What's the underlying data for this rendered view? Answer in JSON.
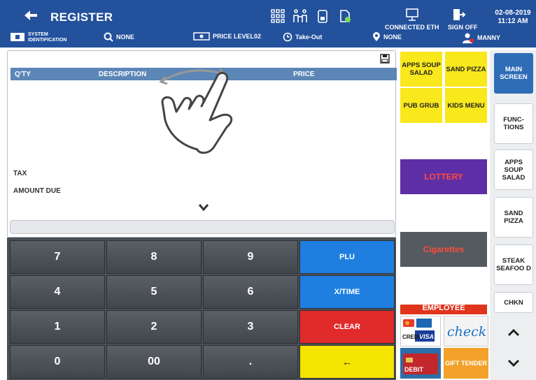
{
  "header": {
    "title": "REGISTER",
    "connected": "CONNECTED ETH",
    "sign_off": "SIGN OFF",
    "date": "02-08-2019",
    "time": "11:12 AM",
    "system_id_line1": "SYSTEM",
    "system_id_line2": "IDENTIFICATION",
    "search_none": "NONE",
    "price_level": "PRICE LEVEL02",
    "take_out": "Take-Out",
    "location_none": "NONE",
    "user": "MANNY"
  },
  "transaction": {
    "col_qty": "Q'TY",
    "col_description": "DESCRIPTION",
    "col_price": "PRICE",
    "tax_label": "TAX",
    "amount_due_label": "AMOUNT DUE"
  },
  "keypad": {
    "k7": "7",
    "k8": "8",
    "k9": "9",
    "k4": "4",
    "k5": "5",
    "k6": "6",
    "k1": "1",
    "k2": "2",
    "k3": "3",
    "k0": "0",
    "k00": "00",
    "kdot": ".",
    "plu": "PLU",
    "xtime": "X/TIME",
    "clear": "CLEAR",
    "enter": "←"
  },
  "departments": {
    "apps_soup_salad": "APPS SOUP SALAD",
    "sand_pizza": "SAND PIZZA",
    "pub_grub": "PUB GRUB",
    "kids_menu": "KIDS MENU",
    "lottery": "LOTTERY",
    "cigarettes": "Cigarettes",
    "employee": "EMPLOYEE"
  },
  "payments": {
    "credit": "CREDIT",
    "visa": "VISA",
    "check": "check",
    "debit": "DEBIT",
    "gift_tender": "GIFT TENDER"
  },
  "sidebar": {
    "main_screen": "MAIN SCREEN",
    "functions": "FUNC-TIONS",
    "apps_soup_salad": "APPS SOUP SALAD",
    "sand_pizza": "SAND PIZZA",
    "steak_seafood": "STEAK SEAFOO D",
    "chkn": "CHKN"
  },
  "colors": {
    "header": "#23519c",
    "column_header": "#5b86b6",
    "plu_blue": "#1e7fe0",
    "clear_red": "#e12a2a",
    "enter_yellow": "#f5e300",
    "dept_yellow": "#f8e81c",
    "lottery_purple": "#5e2ea6",
    "active_tab": "#2f6db7"
  }
}
